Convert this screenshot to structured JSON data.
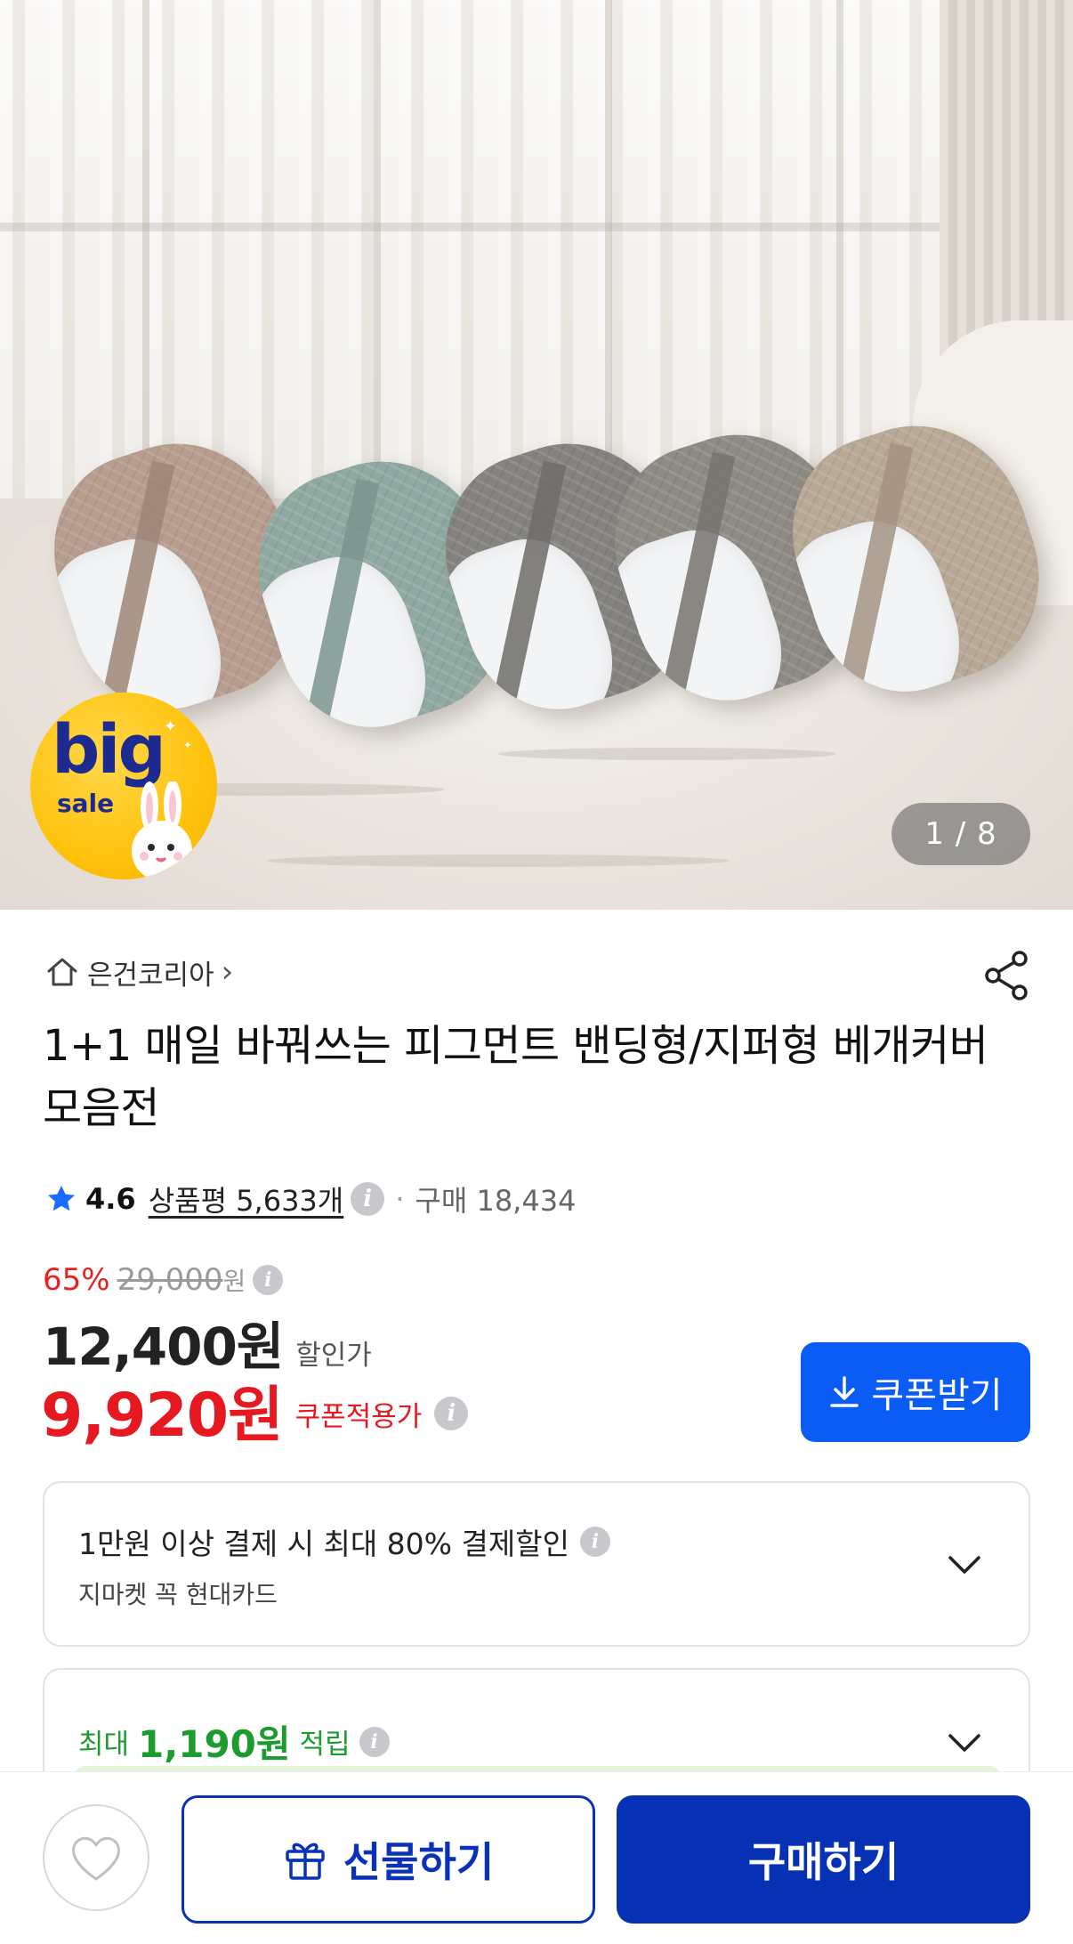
{
  "hero": {
    "image_alt": "pillows",
    "counter": "1 / 8",
    "badge_big": "big",
    "badge_sale": "sale"
  },
  "store": {
    "name": "은건코리아",
    "chevron": "›",
    "home_icon": "home-icon",
    "share_icon": "share-icon"
  },
  "product": {
    "title": "1+1 매일 바꿔쓰는 피그먼트 밴딩형/지퍼형 베개커버 모음전"
  },
  "rating": {
    "score": "4.6",
    "review_label": "상품평 5,633개",
    "separator": "·",
    "purchase": "구매 18,434",
    "star_color": "#1a6bff"
  },
  "price": {
    "discount_pct": "65%",
    "original": "29,000",
    "original_unit": "원",
    "sale": "12,400원",
    "sale_label": "할인가",
    "coupon_price": "9,920원",
    "coupon_label": "쿠폰적용가",
    "coupon_button": "쿠폰받기",
    "accent_red": "#e5191f",
    "accent_blue": "#0a5cf5"
  },
  "payment_card": {
    "title": "1만원 이상 결제 시 최대 80% 결제할인",
    "subtitle": "지마켓 꼭 현대카드"
  },
  "points_card": {
    "prefix": "최대",
    "amount": "1,190원",
    "suffix": "적립",
    "color": "#1c9b2e"
  },
  "bottom_bar": {
    "gift_label": "선물하기",
    "buy_label": "구매하기",
    "wish_icon": "heart-icon",
    "gift_icon": "gift-icon",
    "brand_navy": "#0731b5"
  }
}
